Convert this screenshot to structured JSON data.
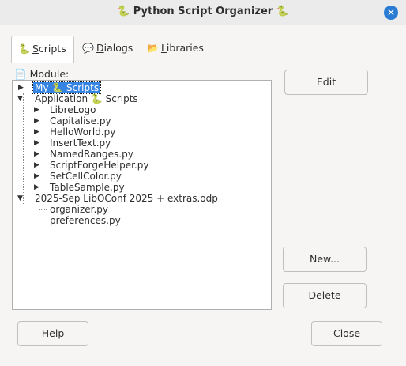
{
  "window": {
    "title": "🐍 Python Script Organizer 🐍",
    "close_glyph": "✕"
  },
  "tabs": [
    {
      "icon": "🐍",
      "mnemonic": "S",
      "rest": "cripts"
    },
    {
      "icon": "💬",
      "mnemonic": "D",
      "rest": "ialogs"
    },
    {
      "icon": "📂",
      "mnemonic": "L",
      "rest": "ibraries"
    }
  ],
  "module_label": {
    "icon": "📄",
    "text": "Module:"
  },
  "tree": {
    "my_scripts": "My 🐍 Scripts",
    "application_scripts": "Application 🐍 Scripts",
    "app_children": [
      "LibreLogo",
      "Capitalise.py",
      "HelloWorld.py",
      "InsertText.py",
      "NamedRanges.py",
      "ScriptForgeHelper.py",
      "SetCellColor.py",
      "TableSample.py"
    ],
    "document": "2025-Sep LibOConf 2025 + extras.odp",
    "doc_children": [
      "organizer.py",
      "preferences.py"
    ]
  },
  "buttons": {
    "edit": "Edit",
    "new": "New...",
    "delete": "Delete",
    "help": "Help",
    "close": "Close"
  }
}
